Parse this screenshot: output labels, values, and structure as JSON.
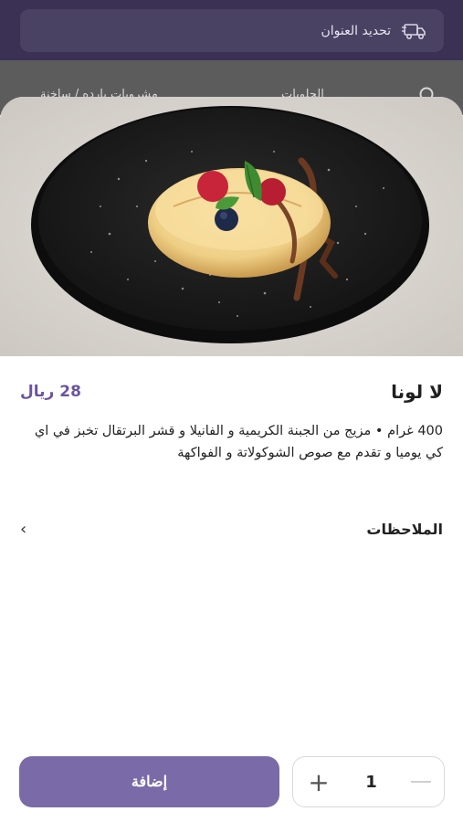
{
  "header": {
    "address_label": "تحديد العنوان",
    "icon": "delivery-truck-icon"
  },
  "nav": {
    "items": [
      "الحلويات",
      "مشروبات بارده / ساخنة"
    ],
    "search_icon": "search-icon"
  },
  "product": {
    "title": "لا لونا",
    "price": "28 ريال",
    "description": "400 غرام • مزيج من الجبنة الكريمية و الفانيلا و قشر البرتقال تخبز في اي كي يوميا و تقدم مع صوص الشوكولاتة و الفواكهة",
    "image_icon": "dessert-photo"
  },
  "notes": {
    "label": "الملاحظات",
    "icon": "chevron-right-icon"
  },
  "footer": {
    "add_label": "إضافة",
    "quantity": "1",
    "plus_icon": "plus-icon",
    "minus_icon": "minus-icon"
  },
  "colors": {
    "brand": "#7a6aa8",
    "price": "#6b54a0",
    "header_bg": "#3a3155"
  }
}
